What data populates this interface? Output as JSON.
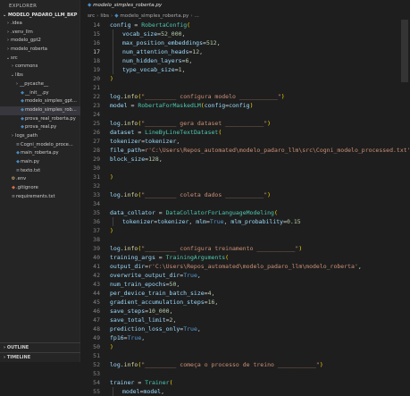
{
  "explorer": {
    "title": "EXPLORER",
    "root": "MODELO_PADARO_LLM_BKP",
    "items": [
      {
        "label": ".idea",
        "chev": "›",
        "icon": "",
        "iconc": "",
        "lvl": 1,
        "sel": false
      },
      {
        "label": ".venv_llm",
        "chev": "›",
        "icon": "",
        "iconc": "",
        "lvl": 1,
        "sel": false
      },
      {
        "label": "modelo_gpt2",
        "chev": "›",
        "icon": "",
        "iconc": "",
        "lvl": 1,
        "sel": false
      },
      {
        "label": "modelo_roberta",
        "chev": "›",
        "icon": "",
        "iconc": "",
        "lvl": 1,
        "sel": false
      },
      {
        "label": "src",
        "chev": "⌄",
        "icon": "",
        "iconc": "",
        "lvl": 1,
        "sel": false
      },
      {
        "label": "commons",
        "chev": "›",
        "icon": "",
        "iconc": "",
        "lvl": 2,
        "sel": false
      },
      {
        "label": "libs",
        "chev": "⌄",
        "icon": "",
        "iconc": "",
        "lvl": 2,
        "sel": false
      },
      {
        "label": "__pycache__",
        "chev": "›",
        "icon": "",
        "iconc": "",
        "lvl": 3,
        "sel": false
      },
      {
        "label": "__init__.py",
        "chev": "",
        "icon": "◆",
        "iconc": "py",
        "lvl": 3,
        "sel": false
      },
      {
        "label": "modelo_simples_gpt...",
        "chev": "",
        "icon": "◆",
        "iconc": "py",
        "lvl": 3,
        "sel": false
      },
      {
        "label": "modelo_simples_rob...",
        "chev": "",
        "icon": "◆",
        "iconc": "py",
        "lvl": 3,
        "sel": true
      },
      {
        "label": "prova_real_roberta.py",
        "chev": "",
        "icon": "◆",
        "iconc": "py",
        "lvl": 3,
        "sel": false
      },
      {
        "label": "prova_real.py",
        "chev": "",
        "icon": "◆",
        "iconc": "py",
        "lvl": 3,
        "sel": false
      },
      {
        "label": "logs_path",
        "chev": "›",
        "icon": "",
        "iconc": "",
        "lvl": 2,
        "sel": false
      },
      {
        "label": "Cogni_modelo_proce...",
        "chev": "",
        "icon": "≡",
        "iconc": "txt",
        "lvl": 2,
        "sel": false
      },
      {
        "label": "main_roberta.py",
        "chev": "",
        "icon": "◆",
        "iconc": "py",
        "lvl": 2,
        "sel": false
      },
      {
        "label": "main.py",
        "chev": "",
        "icon": "◆",
        "iconc": "py",
        "lvl": 2,
        "sel": false
      },
      {
        "label": "texto.txt",
        "chev": "",
        "icon": "≡",
        "iconc": "txt",
        "lvl": 2,
        "sel": false
      },
      {
        "label": ".env",
        "chev": "",
        "icon": "⚙",
        "iconc": "env",
        "lvl": 1,
        "sel": false
      },
      {
        "label": ".gitignore",
        "chev": "",
        "icon": "◆",
        "iconc": "git",
        "lvl": 1,
        "sel": false
      },
      {
        "label": "requirements.txt",
        "chev": "",
        "icon": "≡",
        "iconc": "txt",
        "lvl": 1,
        "sel": false
      }
    ],
    "outline": "OUTLINE",
    "timeline": "TIMELINE"
  },
  "breadcrumb": {
    "parts": [
      "src",
      "libs",
      "modelo_simples_roberta.py",
      "..."
    ],
    "tab": "modelo_simples_roberta.py"
  },
  "editor": {
    "current_line": 17,
    "lines": [
      {
        "n": 14,
        "ind": 0,
        "t": [
          [
            "config",
            "var"
          ],
          [
            " = ",
            ""
          ],
          [
            "RobertaConfig",
            "cls"
          ],
          [
            "(",
            "br1"
          ]
        ]
      },
      {
        "n": 15,
        "ind": 1,
        "t": [
          [
            "vocab_size",
            "var"
          ],
          [
            "=",
            ""
          ],
          [
            "52_000",
            "num"
          ],
          [
            ",",
            ""
          ]
        ]
      },
      {
        "n": 16,
        "ind": 1,
        "t": [
          [
            "max_position_embeddings",
            "var"
          ],
          [
            "=",
            ""
          ],
          [
            "512",
            "num"
          ],
          [
            ",",
            ""
          ]
        ]
      },
      {
        "n": 17,
        "ind": 1,
        "t": [
          [
            "num_attention_heads",
            "var"
          ],
          [
            "=",
            ""
          ],
          [
            "12",
            "num"
          ],
          [
            ",",
            ""
          ]
        ]
      },
      {
        "n": 18,
        "ind": 1,
        "t": [
          [
            "num_hidden_layers",
            "var"
          ],
          [
            "=",
            ""
          ],
          [
            "6",
            "num"
          ],
          [
            ",",
            ""
          ]
        ]
      },
      {
        "n": 19,
        "ind": 1,
        "t": [
          [
            "type_vocab_size",
            "var"
          ],
          [
            "=",
            ""
          ],
          [
            "1",
            "num"
          ],
          [
            ",",
            ""
          ]
        ]
      },
      {
        "n": 20,
        "ind": 0,
        "t": [
          [
            ")",
            "br1"
          ]
        ]
      },
      {
        "n": 21,
        "ind": 0,
        "t": []
      },
      {
        "n": 22,
        "ind": 0,
        "t": [
          [
            "log",
            "var"
          ],
          [
            ".",
            ""
          ],
          [
            "info",
            "fn"
          ],
          [
            "(",
            "br1"
          ],
          [
            "\"_________ configura modelo ___________\"",
            "str"
          ],
          [
            ")",
            "br1"
          ]
        ]
      },
      {
        "n": 23,
        "ind": 0,
        "t": [
          [
            "model",
            "var"
          ],
          [
            " = ",
            ""
          ],
          [
            "RobertaForMaskedLM",
            "cls"
          ],
          [
            "(",
            "br1"
          ],
          [
            "config",
            "var"
          ],
          [
            "=",
            ""
          ],
          [
            "config",
            "var"
          ],
          [
            ")",
            "br1"
          ]
        ]
      },
      {
        "n": 24,
        "ind": 0,
        "t": []
      },
      {
        "n": 25,
        "ind": 0,
        "t": [
          [
            "log",
            "var"
          ],
          [
            ".",
            ""
          ],
          [
            "info",
            "fn"
          ],
          [
            "(",
            "br1"
          ],
          [
            "\"_________ gera dataset ___________\"",
            "str"
          ],
          [
            ")",
            "br1"
          ]
        ]
      },
      {
        "n": 26,
        "ind": 0,
        "t": [
          [
            "dataset",
            "var"
          ],
          [
            " = ",
            ""
          ],
          [
            "LineByLineTextDataset",
            "cls"
          ],
          [
            "(",
            "br1"
          ]
        ]
      },
      {
        "n": 27,
        "ind": 0,
        "t": [
          [
            "tokenizer",
            "var"
          ],
          [
            "=",
            ""
          ],
          [
            "tokenizer",
            "var"
          ],
          [
            ",",
            ""
          ]
        ]
      },
      {
        "n": 28,
        "ind": 0,
        "t": [
          [
            "file_path",
            "var"
          ],
          [
            "=",
            ""
          ],
          [
            "r'C:\\Users\\Repos_automated\\modelo_padaro_llm\\src\\Cogni_modelo_processed.txt'",
            "str"
          ],
          [
            ",",
            ""
          ]
        ]
      },
      {
        "n": 29,
        "ind": 0,
        "t": [
          [
            "block_size",
            "var"
          ],
          [
            "=",
            ""
          ],
          [
            "128",
            "num"
          ],
          [
            ",",
            ""
          ]
        ]
      },
      {
        "n": 30,
        "ind": 0,
        "t": []
      },
      {
        "n": 31,
        "ind": 0,
        "t": [
          [
            ")",
            "br1"
          ]
        ]
      },
      {
        "n": 32,
        "ind": 0,
        "t": []
      },
      {
        "n": 33,
        "ind": 0,
        "t": [
          [
            "log",
            "var"
          ],
          [
            ".",
            ""
          ],
          [
            "info",
            "fn"
          ],
          [
            "(",
            "br1"
          ],
          [
            "\"_________ coleta dados ___________\"",
            "str"
          ],
          [
            ")",
            "br1"
          ]
        ]
      },
      {
        "n": 34,
        "ind": 0,
        "t": []
      },
      {
        "n": 35,
        "ind": 0,
        "t": [
          [
            "data_collator",
            "var"
          ],
          [
            " = ",
            ""
          ],
          [
            "DataCollatorForLanguageModeling",
            "cls"
          ],
          [
            "(",
            "br1"
          ]
        ]
      },
      {
        "n": 36,
        "ind": 1,
        "t": [
          [
            "tokenizer",
            "var"
          ],
          [
            "=",
            ""
          ],
          [
            "tokenizer",
            "var"
          ],
          [
            ", ",
            ""
          ],
          [
            "mlm",
            "var"
          ],
          [
            "=",
            ""
          ],
          [
            "True",
            "kw"
          ],
          [
            ", ",
            ""
          ],
          [
            "mlm_probability",
            "var"
          ],
          [
            "=",
            ""
          ],
          [
            "0.15",
            "num"
          ]
        ]
      },
      {
        "n": 37,
        "ind": 0,
        "t": [
          [
            ")",
            "br1"
          ]
        ]
      },
      {
        "n": 38,
        "ind": 0,
        "t": []
      },
      {
        "n": 39,
        "ind": 0,
        "t": [
          [
            "log",
            "var"
          ],
          [
            ".",
            ""
          ],
          [
            "info",
            "fn"
          ],
          [
            "(",
            "br1"
          ],
          [
            "\"_________ configura treinamento ___________\"",
            "str"
          ],
          [
            ")",
            "br1"
          ]
        ]
      },
      {
        "n": 40,
        "ind": 0,
        "t": [
          [
            "training_args",
            "var"
          ],
          [
            " = ",
            ""
          ],
          [
            "TrainingArguments",
            "cls"
          ],
          [
            "(",
            "br1"
          ]
        ]
      },
      {
        "n": 41,
        "ind": 0,
        "t": [
          [
            "output_dir",
            "var"
          ],
          [
            "=",
            ""
          ],
          [
            "r'C:\\Users\\Repos_automated\\modelo_padaro_llm\\modelo_roberta'",
            "str"
          ],
          [
            ",",
            ""
          ]
        ]
      },
      {
        "n": 42,
        "ind": 0,
        "t": [
          [
            "overwrite_output_dir",
            "var"
          ],
          [
            "=",
            ""
          ],
          [
            "True",
            "kw"
          ],
          [
            ",",
            ""
          ]
        ]
      },
      {
        "n": 43,
        "ind": 0,
        "t": [
          [
            "num_train_epochs",
            "var"
          ],
          [
            "=",
            ""
          ],
          [
            "50",
            "num"
          ],
          [
            ",",
            ""
          ]
        ]
      },
      {
        "n": 44,
        "ind": 0,
        "t": [
          [
            "per_device_train_batch_size",
            "var"
          ],
          [
            "=",
            ""
          ],
          [
            "4",
            "num"
          ],
          [
            ",",
            ""
          ]
        ]
      },
      {
        "n": 45,
        "ind": 0,
        "t": [
          [
            "gradient_accumulation_steps",
            "var"
          ],
          [
            "=",
            ""
          ],
          [
            "16",
            "num"
          ],
          [
            ",",
            ""
          ]
        ]
      },
      {
        "n": 46,
        "ind": 0,
        "t": [
          [
            "save_steps",
            "var"
          ],
          [
            "=",
            ""
          ],
          [
            "10_000",
            "num"
          ],
          [
            ",",
            ""
          ]
        ]
      },
      {
        "n": 47,
        "ind": 0,
        "t": [
          [
            "save_total_limit",
            "var"
          ],
          [
            "=",
            ""
          ],
          [
            "2",
            "num"
          ],
          [
            ",",
            ""
          ]
        ]
      },
      {
        "n": 48,
        "ind": 0,
        "t": [
          [
            "prediction_loss_only",
            "var"
          ],
          [
            "=",
            ""
          ],
          [
            "True",
            "kw"
          ],
          [
            ",",
            ""
          ]
        ]
      },
      {
        "n": 49,
        "ind": 0,
        "t": [
          [
            "fp16",
            "var"
          ],
          [
            "=",
            ""
          ],
          [
            "True",
            "kw"
          ],
          [
            ",",
            ""
          ]
        ]
      },
      {
        "n": 50,
        "ind": 0,
        "t": [
          [
            ")",
            "br1"
          ]
        ]
      },
      {
        "n": 51,
        "ind": 0,
        "t": []
      },
      {
        "n": 52,
        "ind": 0,
        "t": [
          [
            "log",
            "var"
          ],
          [
            ".",
            ""
          ],
          [
            "info",
            "fn"
          ],
          [
            "(",
            "br1"
          ],
          [
            "\"_________ começa o processo de treino ___________\"",
            "str"
          ],
          [
            ")",
            "br1"
          ]
        ]
      },
      {
        "n": 53,
        "ind": 0,
        "t": []
      },
      {
        "n": 54,
        "ind": 0,
        "t": [
          [
            "trainer",
            "var"
          ],
          [
            " = ",
            ""
          ],
          [
            "Trainer",
            "cls"
          ],
          [
            "(",
            "br1"
          ]
        ]
      },
      {
        "n": 55,
        "ind": 1,
        "t": [
          [
            "model",
            "var"
          ],
          [
            "=",
            ""
          ],
          [
            "model",
            "var"
          ],
          [
            ",",
            ""
          ]
        ]
      }
    ]
  },
  "colors": {
    "background": "#1e1e1e",
    "sidebar": "#252526",
    "selection": "#37373d"
  }
}
